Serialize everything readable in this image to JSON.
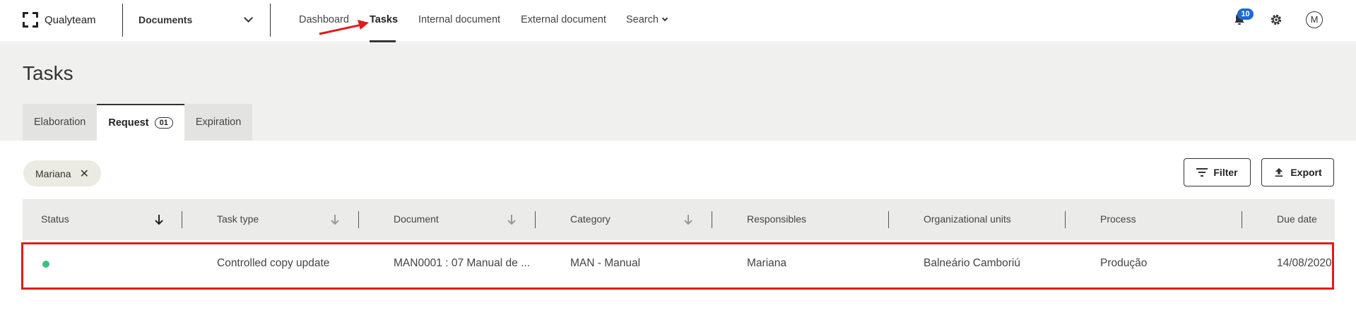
{
  "app": {
    "name": "Qualyteam"
  },
  "module_select": {
    "label": "Documents"
  },
  "nav": {
    "items": [
      {
        "label": "Dashboard"
      },
      {
        "label": "Tasks"
      },
      {
        "label": "Internal document"
      },
      {
        "label": "External document"
      },
      {
        "label": "Search"
      }
    ]
  },
  "header_icons": {
    "notifications_count": "10",
    "avatar_initial": "M"
  },
  "page": {
    "title": "Tasks"
  },
  "tabs": [
    {
      "label": "Elaboration"
    },
    {
      "label": "Request",
      "count": "01"
    },
    {
      "label": "Expiration"
    }
  ],
  "filters": {
    "active_chip": "Mariana",
    "filter_label": "Filter",
    "export_label": "Export"
  },
  "table": {
    "columns": [
      "Status",
      "Task type",
      "Document",
      "Category",
      "Responsibles",
      "Organizational units",
      "Process",
      "Due date"
    ],
    "rows": [
      {
        "status": "active",
        "task_type": "Controlled copy update",
        "document": "MAN0001 : 07 Manual de ...",
        "category": "MAN - Manual",
        "responsibles": "Mariana",
        "organizational_units": "Balneário Camboriú",
        "process": "Produção",
        "due_date": "14/08/2020"
      }
    ]
  },
  "colors": {
    "accent": "#1a6bd6",
    "status_green": "#3ec27a",
    "highlight_red": "#e01b1b"
  }
}
